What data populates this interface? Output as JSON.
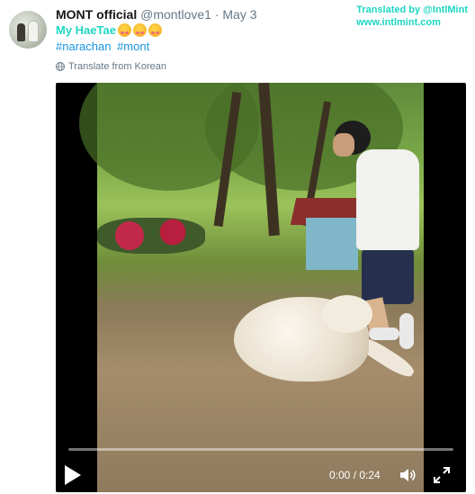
{
  "tweet": {
    "author_name": "MONT official",
    "handle": "@montlove1",
    "separator": "·",
    "date": "May 3",
    "text": "My HaeTae",
    "hashtags": [
      "#narachan",
      "#mont"
    ],
    "translate_label": "Translate from Korean"
  },
  "credit": {
    "line1": "Translated by @IntlMint",
    "line2": "www.intlmint.com"
  },
  "video": {
    "time": "0:00 / 0:24",
    "progress": 0.0
  },
  "icons": {
    "emoji": "kissing-face-icon",
    "globe": "globe-icon",
    "play": "play-icon",
    "volume": "volume-icon",
    "fullscreen": "fullscreen-icon"
  },
  "colors": {
    "hashtag": "#1b95e0",
    "accent_text": "#1dd6c3",
    "video_bg": "#000000"
  }
}
